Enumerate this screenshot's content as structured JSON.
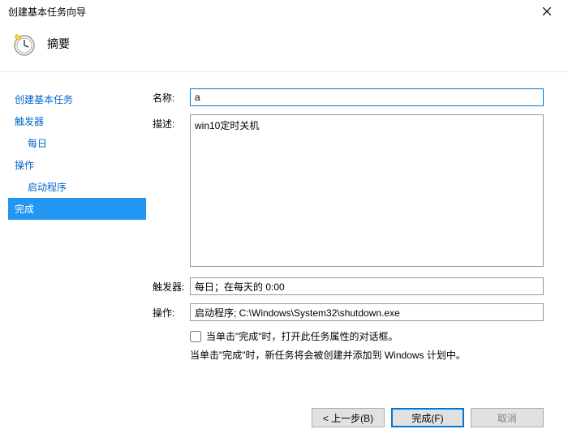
{
  "window": {
    "title": "创建基本任务向导"
  },
  "header": {
    "heading": "摘要"
  },
  "sidebar": {
    "items": [
      {
        "label": "创建基本任务",
        "indent": false
      },
      {
        "label": "触发器",
        "indent": false
      },
      {
        "label": "每日",
        "indent": true
      },
      {
        "label": "操作",
        "indent": false
      },
      {
        "label": "启动程序",
        "indent": true
      },
      {
        "label": "完成",
        "indent": false,
        "selected": true
      }
    ]
  },
  "form": {
    "name_label": "名称:",
    "name_value": "a",
    "desc_label": "描述:",
    "desc_value": "win10定时关机",
    "trigger_label": "触发器:",
    "trigger_value": "每日；在每天的 0:00",
    "action_label": "操作:",
    "action_value": "启动程序; C:\\Windows\\System32\\shutdown.exe",
    "checkbox_label": "当单击\"完成\"时，打开此任务属性的对话框。",
    "note": "当单击\"完成\"时，新任务将会被创建并添加到 Windows 计划中。"
  },
  "buttons": {
    "back": "< 上一步(B)",
    "finish": "完成(F)",
    "cancel": "取消"
  }
}
